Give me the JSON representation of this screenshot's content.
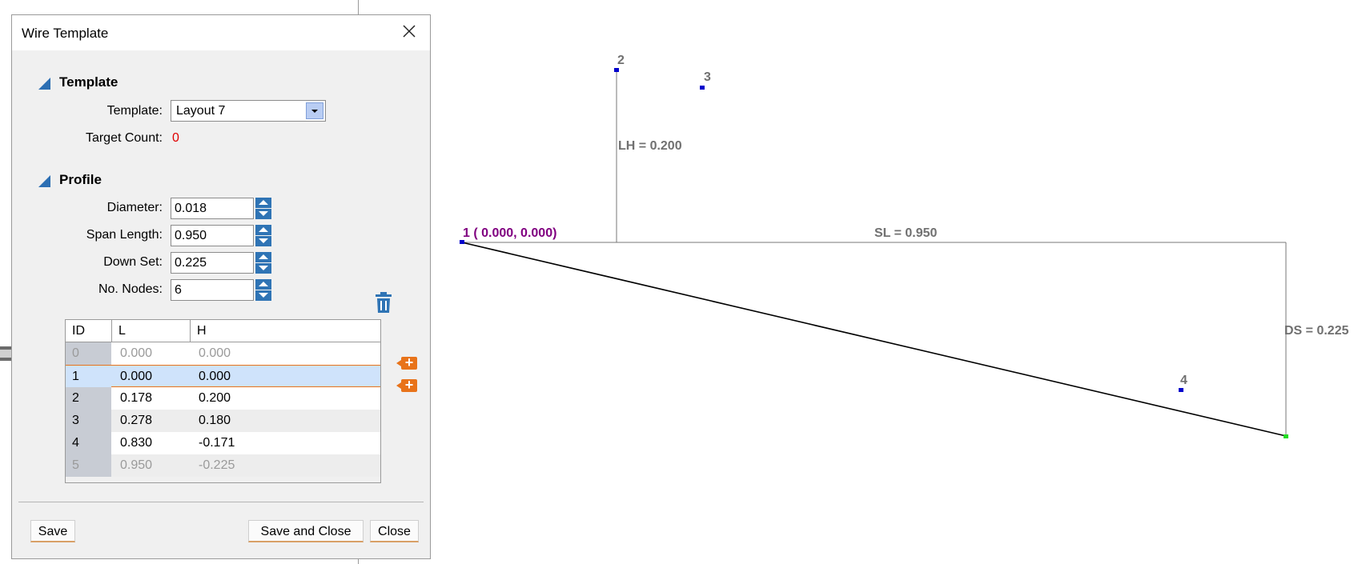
{
  "dialog": {
    "title": "Wire Template",
    "template_section": "Template",
    "template_label": "Template:",
    "template_value": "Layout 7",
    "target_count_label": "Target Count:",
    "target_count_value": "0",
    "profile_section": "Profile",
    "diameter_label": "Diameter:",
    "diameter_value": "0.018",
    "span_length_label": "Span Length:",
    "span_length_value": "0.950",
    "down_set_label": "Down Set:",
    "down_set_value": "0.225",
    "nodes_label": "No. Nodes:",
    "nodes_value": "6",
    "table": {
      "headers": [
        "ID",
        "L",
        "H"
      ],
      "rows": [
        {
          "id": "0",
          "l": "0.000",
          "h": "0.000"
        },
        {
          "id": "1",
          "l": "0.000",
          "h": "0.000"
        },
        {
          "id": "2",
          "l": "0.178",
          "h": "0.200"
        },
        {
          "id": "3",
          "l": "0.278",
          "h": "0.180"
        },
        {
          "id": "4",
          "l": "0.830",
          "h": "-0.171"
        },
        {
          "id": "5",
          "l": "0.950",
          "h": "-0.225"
        }
      ]
    },
    "add_symbol": "+",
    "buttons": {
      "save": "Save",
      "save_close": "Save and Close",
      "close": "Close"
    }
  },
  "drawing": {
    "node1_label": "1 ( 0.000,  0.000)",
    "node2_label": "2",
    "node3_label": "3",
    "node4_label": "4",
    "lh_label": "LH =  0.200",
    "sl_label": "SL =  0.950",
    "ds_label": "DS =  0.225"
  },
  "colors": {
    "accent": "#2f74b5",
    "selection_border": "#e8731a",
    "node": "#0000cc",
    "end_node": "#22dd22",
    "node1_label": "#800080"
  }
}
